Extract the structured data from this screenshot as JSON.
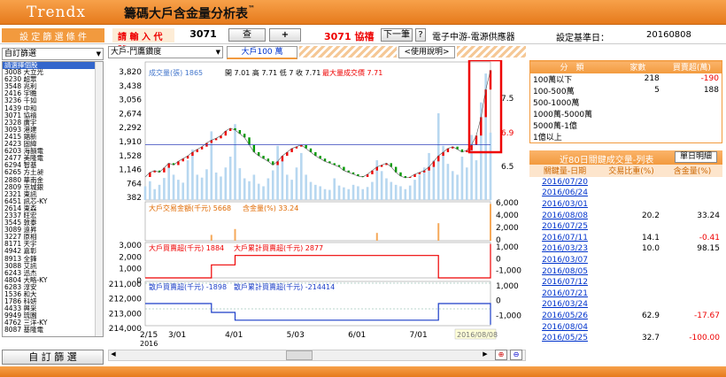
{
  "brand": "Trendx",
  "app_title": "籌碼大戶含金量分析表",
  "app_title_tm": "™",
  "toolbar": {
    "filter_label": "設 定 篩 選 條 件",
    "code_label": "請 輸 入 代 號",
    "code_value": "3071",
    "query_button": "查",
    "add_button": "+",
    "stock_code_name": "3071 協禧",
    "next_button": "下一筆",
    "help_button": "?",
    "industry": "電子中游-電源供應器",
    "base_date_label": "設定基準日：",
    "base_date": "20160808"
  },
  "left": {
    "filter_select": "自訂篩選",
    "custom_filter_button": "自 訂 篩 選",
    "stocks": [
      "請選擇個股",
      "3008 大立光",
      "6230 超眾",
      "3548 兆利",
      "2416 宇瞻",
      "3236 千如",
      "1439 中和",
      "3071 協禧",
      "2328 廣宇",
      "3093 港建",
      "2415 錩新",
      "2423 固緯",
      "6203 海韻電",
      "2477 美隆電",
      "6294 智基",
      "6265 方土昶",
      "2880 華南金",
      "2809 京城銀",
      "2321 東訊",
      "6451 訊芯-KY",
      "2614 東森",
      "2337 旺宏",
      "3545 敦泰",
      "3089 遠昇",
      "3227 原相",
      "8171 天宇",
      "4942 嘉彰",
      "8913 全鋒",
      "3088 艾訊",
      "6243 迅杰",
      "4804 大略-KY",
      "6283 淳安",
      "1536 和大",
      "1786 科妍",
      "4433 興采",
      "9949 琉園",
      "4762 三洋-KY",
      "8087 基隆電"
    ]
  },
  "chart_header": {
    "range_select": "大戶-鬥鷹鑽度",
    "tab_active": "大戶100 萬",
    "usage_button": "<使用說明>"
  },
  "chart_data": [
    {
      "type": "line",
      "panel": "price-volume",
      "legend": [
        "成交量(張) 1865",
        "開 7.01",
        "高 7.71",
        "低 7",
        "收 7.71",
        "最大量成交價 7.71"
      ],
      "yticks_left": [
        "3,820",
        "3,438",
        "3,056",
        "2,674",
        "2,292",
        "1,910",
        "1,528",
        "1,146",
        "764",
        "382"
      ],
      "yticks_right": [
        "7.5",
        "6.9",
        "6.5"
      ],
      "ylim_price": [
        6.3,
        7.8
      ],
      "ylim_volume": [
        0,
        3820
      ],
      "price": [
        6.55,
        6.6,
        6.62,
        6.6,
        6.65,
        6.7,
        6.68,
        6.72,
        6.75,
        6.78,
        6.82,
        6.85,
        6.88,
        6.92,
        6.95,
        6.97,
        7.0,
        7.05,
        7.08,
        7.06,
        7.02,
        6.98,
        6.9,
        6.82,
        6.78,
        6.75,
        6.72,
        6.68,
        6.72,
        6.78,
        6.82,
        6.86,
        6.88,
        6.9,
        6.86,
        6.82,
        6.78,
        6.75,
        6.72,
        6.7,
        6.68,
        6.66,
        6.62,
        6.6,
        6.58,
        6.56,
        6.55,
        6.58,
        6.62,
        6.66,
        6.68,
        6.7,
        6.66,
        6.6,
        6.56,
        6.54,
        6.55,
        6.58,
        6.6,
        6.62,
        6.66,
        6.72,
        6.78,
        6.82,
        6.86,
        6.88,
        6.85,
        6.82,
        6.84,
        6.9,
        7.0,
        7.2,
        7.5,
        7.71
      ],
      "volume": [
        380,
        520,
        300,
        420,
        610,
        900,
        700,
        560,
        480,
        1100,
        1400,
        700,
        620,
        850,
        1900,
        760,
        650,
        900,
        1200,
        2100,
        880,
        600,
        520,
        700,
        450,
        380,
        600,
        820,
        1500,
        1100,
        700,
        560,
        900,
        1300,
        700,
        500,
        420,
        380,
        300,
        280,
        600,
        400,
        350,
        300,
        420,
        380,
        300,
        360,
        500,
        1100,
        800,
        600,
        500,
        420,
        380,
        300,
        400,
        560,
        700,
        900,
        1300,
        1100,
        2400,
        1500,
        1000,
        800,
        700,
        1200,
        900,
        1800,
        1100,
        2700,
        3500,
        1865
      ],
      "x_ticks": [
        "2/15\n2016",
        "3/01",
        "4/01",
        "5/03",
        "6/01",
        "7/01"
      ],
      "highlight_date": "2016/08/08"
    },
    {
      "type": "bar",
      "panel": "big-holder-amount",
      "legend": [
        "大戶交易金額(千元) 5668",
        "含金量(%) 33.24"
      ],
      "yticks_right": [
        "6,000",
        "4,000",
        "2,000",
        "0"
      ],
      "ylim": [
        0,
        6000
      ],
      "values": [
        0,
        0,
        0,
        0,
        0,
        0,
        0,
        0,
        0,
        0,
        0,
        0,
        0,
        0,
        900,
        0,
        0,
        0,
        0,
        1800,
        0,
        0,
        0,
        0,
        0,
        0,
        0,
        0,
        0,
        0,
        0,
        0,
        0,
        0,
        0,
        0,
        0,
        0,
        0,
        0,
        0,
        0,
        0,
        0,
        0,
        0,
        0,
        0,
        0,
        1200,
        0,
        0,
        0,
        0,
        0,
        0,
        0,
        0,
        0,
        0,
        0,
        0,
        2700,
        0,
        0,
        0,
        0,
        0,
        0,
        0,
        0,
        0,
        0,
        5668
      ]
    },
    {
      "type": "line",
      "panel": "big-holder-net",
      "legend": [
        "大戶買賣超(千元) 1884",
        "大戶累計買賣超(千元) 2877"
      ],
      "yticks_left": [
        "3,000",
        "2,000",
        "1,000",
        "0"
      ],
      "yticks_right": [
        "1,000",
        "0",
        "-1,000"
      ],
      "ylim": [
        0,
        3000
      ],
      "cumulative": [
        0,
        0,
        0,
        0,
        0,
        0,
        0,
        0,
        0,
        0,
        0,
        0,
        0,
        0,
        1100,
        1100,
        1100,
        1100,
        1100,
        1900,
        1900,
        1900,
        1900,
        1900,
        1900,
        1900,
        1900,
        1900,
        1900,
        1900,
        1900,
        1900,
        1900,
        1900,
        1900,
        1900,
        1900,
        1900,
        1900,
        1900,
        1900,
        1900,
        1900,
        1900,
        1900,
        1900,
        1900,
        1900,
        1900,
        1900,
        1900,
        1900,
        1900,
        1900,
        1900,
        1900,
        1900,
        1900,
        1900,
        1900,
        1900,
        1900,
        0,
        0,
        0,
        0,
        0,
        0,
        0,
        0,
        0,
        0,
        0,
        2877
      ]
    },
    {
      "type": "line",
      "panel": "retail-net",
      "legend": [
        "散戶買賣超(千元) -1898",
        "散戶累計買賣超(千元) -214414"
      ],
      "yticks_left": [
        "-211,000",
        "-212,000",
        "-213,000",
        "-214,000"
      ],
      "yticks_right": [
        "1,000",
        "0",
        "-1,000"
      ],
      "ylim": [
        -214500,
        -210500
      ],
      "cumulative": [
        -212500,
        -212500,
        -212500,
        -212500,
        -212500,
        -212500,
        -212500,
        -212500,
        -212500,
        -212500,
        -212500,
        -212500,
        -212500,
        -212500,
        -213300,
        -213300,
        -213300,
        -213300,
        -213300,
        -214000,
        -214000,
        -214000,
        -214000,
        -214000,
        -214000,
        -214000,
        -214000,
        -214000,
        -214000,
        -214000,
        -214000,
        -214000,
        -214000,
        -214000,
        -214000,
        -214000,
        -214000,
        -214000,
        -214000,
        -214000,
        -214000,
        -214000,
        -214000,
        -214000,
        -214000,
        -214000,
        -214000,
        -214000,
        -214000,
        -214000,
        -214000,
        -214000,
        -214000,
        -214000,
        -214000,
        -214000,
        -214000,
        -214000,
        -214000,
        -214000,
        -214000,
        -214000,
        -212500,
        -212500,
        -212500,
        -212500,
        -212500,
        -212500,
        -212500,
        -212500,
        -212500,
        -212500,
        -212500,
        -214414
      ]
    }
  ],
  "right": {
    "summary_headers": [
      "分　類",
      "家數",
      "買賣超(萬)"
    ],
    "summary_rows": [
      {
        "cat": "100萬以下",
        "count": "218",
        "net": "-190"
      },
      {
        "cat": "100-500萬",
        "count": "5",
        "net": "188"
      },
      {
        "cat": "500-1000萬",
        "count": "",
        "net": ""
      },
      {
        "cat": "1000萬-5000萬",
        "count": "",
        "net": ""
      },
      {
        "cat": "5000萬-1億",
        "count": "",
        "net": ""
      },
      {
        "cat": "1億以上",
        "count": "",
        "net": ""
      }
    ],
    "list_title": "近80日關鍵成交量-列表",
    "list_button": "單日明細",
    "list_headers": [
      "關鍵量-日期",
      "交易比重(%)",
      "含金量(%)"
    ],
    "list_rows": [
      {
        "date": "2016/07/20",
        "ratio": "",
        "gold": ""
      },
      {
        "date": "2016/06/24",
        "ratio": "",
        "gold": ""
      },
      {
        "date": "2016/03/01",
        "ratio": "",
        "gold": ""
      },
      {
        "date": "2016/08/08",
        "ratio": "20.2",
        "gold": "33.24"
      },
      {
        "date": "2016/07/25",
        "ratio": "",
        "gold": ""
      },
      {
        "date": "2016/07/11",
        "ratio": "14.1",
        "gold": "-0.41"
      },
      {
        "date": "2016/03/23",
        "ratio": "10.0",
        "gold": "98.15"
      },
      {
        "date": "2016/03/07",
        "ratio": "",
        "gold": ""
      },
      {
        "date": "2016/08/05",
        "ratio": "",
        "gold": ""
      },
      {
        "date": "2016/07/12",
        "ratio": "",
        "gold": ""
      },
      {
        "date": "2016/07/21",
        "ratio": "",
        "gold": ""
      },
      {
        "date": "2016/03/24",
        "ratio": "",
        "gold": ""
      },
      {
        "date": "2016/05/26",
        "ratio": "62.9",
        "gold": "-17.67"
      },
      {
        "date": "2016/08/04",
        "ratio": "",
        "gold": ""
      },
      {
        "date": "2016/05/25",
        "ratio": "32.7",
        "gold": "-100.00"
      }
    ]
  },
  "colors": {
    "orange": "#f29a3e",
    "red": "#e60000",
    "blue": "#0033cc",
    "green": "#2a8a2a"
  }
}
